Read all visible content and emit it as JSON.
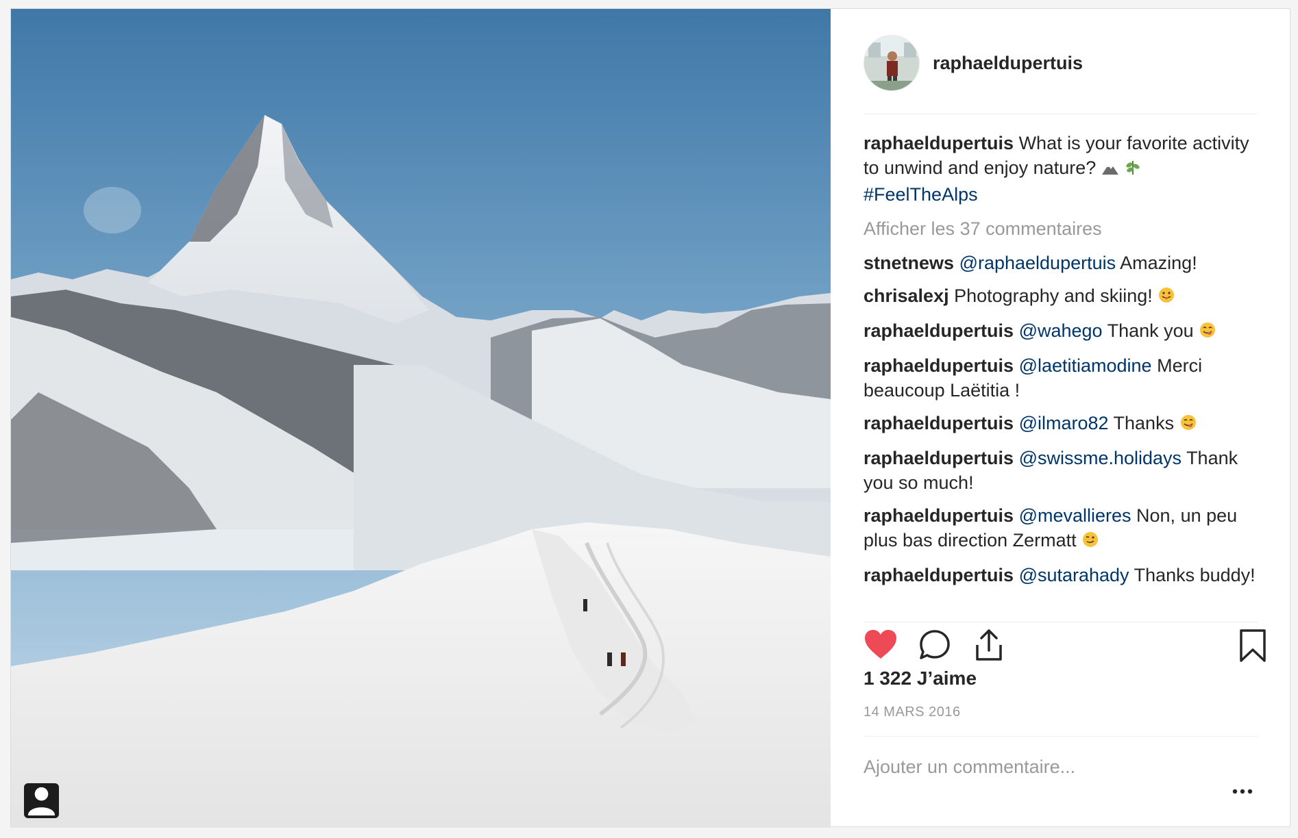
{
  "post": {
    "author": "raphaeldupertuis",
    "caption": {
      "user": "raphaeldupertuis",
      "text": "What is your favorite activity to unwind and enjoy nature?",
      "hashtag": "#FeelTheAlps"
    },
    "view_all_label": "Afficher les 37 commentaires",
    "comments": [
      {
        "user": "stnetnews",
        "mention": "@raphaeldupertuis",
        "text": "Amazing!"
      },
      {
        "user": "chrisalexj",
        "mention": "",
        "text": "Photography and skiing!"
      },
      {
        "user": "raphaeldupertuis",
        "mention": "@wahego",
        "text": "Thank you"
      },
      {
        "user": "raphaeldupertuis",
        "mention": "@laetitiamodine",
        "text": "Merci beaucoup Laëtitia !"
      },
      {
        "user": "raphaeldupertuis",
        "mention": "@ilmaro82",
        "text": "Thanks"
      },
      {
        "user": "raphaeldupertuis",
        "mention": "@swissme.holidays",
        "text": "Thank you so much!"
      },
      {
        "user": "raphaeldupertuis",
        "mention": "@mevallieres",
        "text": "Non, un peu plus bas direction Zermatt"
      },
      {
        "user": "raphaeldupertuis",
        "mention": "@sutarahady",
        "text": "Thanks buddy!"
      }
    ],
    "likes_label": "1 322 J’aime",
    "date_label": "14 MARS 2016",
    "add_comment_placeholder": "Ajouter un commentaire..."
  },
  "icons": {
    "like": "heart-icon-filled",
    "comment": "speech-bubble-icon",
    "share": "share-upload-icon",
    "save": "bookmark-icon",
    "more": "more-dots-icon",
    "tag": "person-tag-icon"
  },
  "colors": {
    "like_red": "#ed4956",
    "mention_blue": "#003569",
    "muted_gray": "#999999",
    "text": "#262626"
  }
}
